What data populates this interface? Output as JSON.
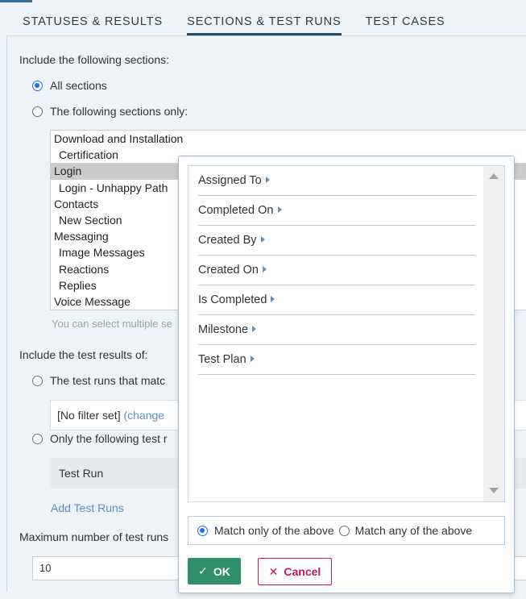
{
  "tabs": [
    {
      "label": "STATUSES & RESULTS"
    },
    {
      "label": "SECTIONS & TEST RUNS"
    },
    {
      "label": "TEST CASES"
    }
  ],
  "sections": {
    "heading": "Include the following sections:",
    "opt_all": "All sections",
    "opt_only": "The following sections only:",
    "items": [
      {
        "label": "Download and Installation",
        "level": 0
      },
      {
        "label": "Certification",
        "level": 1
      },
      {
        "label": "Login",
        "level": 0,
        "selected": true
      },
      {
        "label": "Login - Unhappy Path",
        "level": 1
      },
      {
        "label": "Contacts",
        "level": 0
      },
      {
        "label": "New Section",
        "level": 1
      },
      {
        "label": "Messaging",
        "level": 0
      },
      {
        "label": "Image Messages",
        "level": 1
      },
      {
        "label": "Reactions",
        "level": 1
      },
      {
        "label": "Replies",
        "level": 1
      },
      {
        "label": "Voice Message",
        "level": 0
      }
    ],
    "hint": "You can select multiple se"
  },
  "results": {
    "heading": "Include the test results of:",
    "opt_match": "The test runs that matc",
    "filter_text": "[No filter set] ",
    "filter_link": "(change",
    "opt_only": "Only the following test r",
    "test_run": "Test Run",
    "add_link": "Add Test Runs"
  },
  "max_runs": {
    "label": "Maximum number of test runs",
    "value": "10"
  },
  "popup": {
    "fields": [
      {
        "label": "Assigned To"
      },
      {
        "label": "Completed On"
      },
      {
        "label": "Created By"
      },
      {
        "label": "Created On"
      },
      {
        "label": "Is Completed"
      },
      {
        "label": "Milestone"
      },
      {
        "label": "Test Plan"
      }
    ],
    "match_only": "Match only of the above",
    "match_any": "Match any of the above",
    "ok_label": "OK",
    "cancel_label": "Cancel"
  },
  "colors": {
    "accent": "#1a73e8",
    "ok": "#2f8f6b",
    "cancel": "#c2185b",
    "link": "#5b8fbf"
  }
}
